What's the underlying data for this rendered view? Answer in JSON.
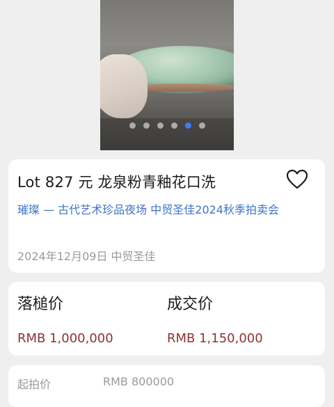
{
  "gallery": {
    "image_icon": "celadon-brush-washer-photo",
    "dot_count": 6,
    "active_index": 4,
    "accent_color": "#3d7bf0"
  },
  "lot": {
    "title": "Lot 827 元  龙泉粉青釉花口洗",
    "session": "璀璨 — 古代艺术珍品夜场 中贸圣佳2024秋季拍卖会",
    "date_house": "2024年12月09日 中贸圣佳",
    "favorite_icon": "heart-outline-icon"
  },
  "prices": {
    "hammer_label": "落槌价",
    "hammer_value": "RMB 1,000,000",
    "deal_label": "成交价",
    "deal_value": "RMB 1,150,000",
    "price_color": "#8f3232"
  },
  "details": {
    "start_label": "起拍价",
    "start_value": "RMB 800000"
  }
}
